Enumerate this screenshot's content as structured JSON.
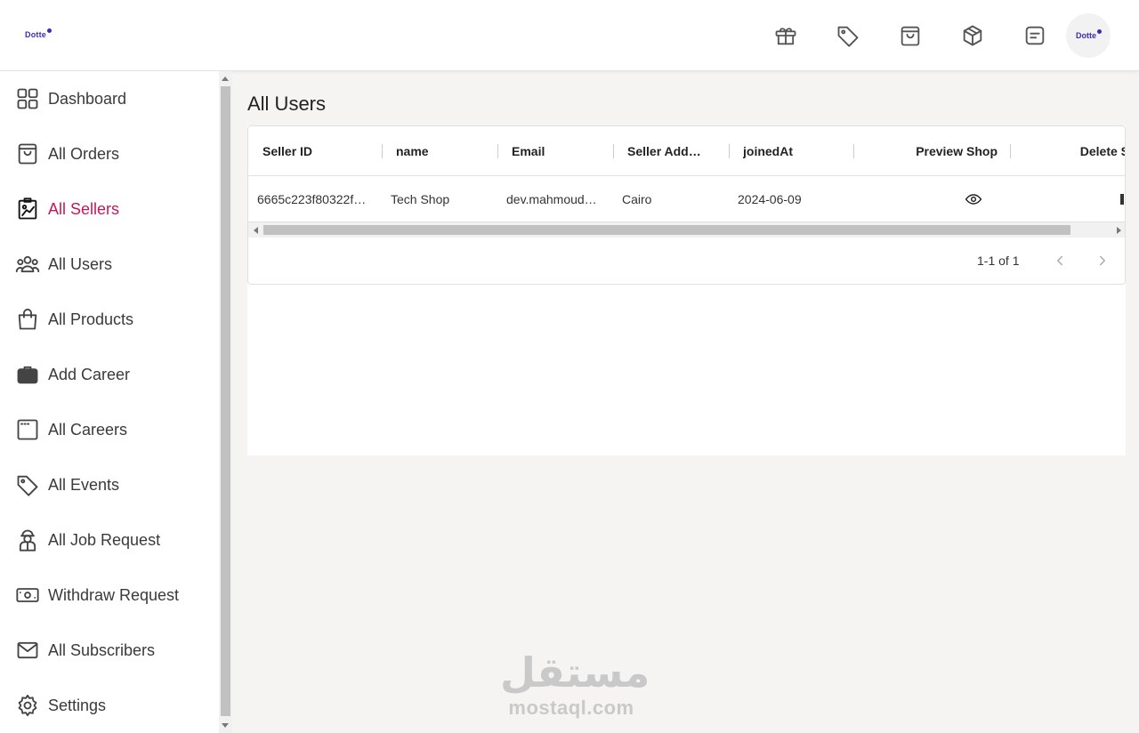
{
  "brand": {
    "logo_text": "Dotte",
    "avatar_text": "Dotte",
    "accent_color": "#3d2bb5"
  },
  "header": {
    "icons": [
      "gift-icon",
      "tag-icon",
      "shopping-bag-icon",
      "package-icon",
      "note-icon"
    ]
  },
  "sidebar": {
    "active_color": "#c2185b",
    "items": [
      {
        "label": "Dashboard",
        "icon": "dashboard-icon",
        "active": false
      },
      {
        "label": "All Orders",
        "icon": "shopping-bag-icon",
        "active": false
      },
      {
        "label": "All Sellers",
        "icon": "seller-icon",
        "active": true
      },
      {
        "label": "All Users",
        "icon": "users-icon",
        "active": false
      },
      {
        "label": "All Products",
        "icon": "product-bag-icon",
        "active": false
      },
      {
        "label": "Add Career",
        "icon": "briefcase-icon",
        "active": false
      },
      {
        "label": "All Careers",
        "icon": "window-icon",
        "active": false
      },
      {
        "label": "All Events",
        "icon": "tag-icon",
        "active": false
      },
      {
        "label": "All Job Request",
        "icon": "worker-icon",
        "active": false
      },
      {
        "label": "Withdraw Request",
        "icon": "money-icon",
        "active": false
      },
      {
        "label": "All Subscribers",
        "icon": "mail-icon",
        "active": false
      },
      {
        "label": "Settings",
        "icon": "gear-icon",
        "active": false
      }
    ]
  },
  "main": {
    "title": "All Users",
    "table": {
      "columns": [
        "Seller ID",
        "name",
        "Email",
        "Seller Add…",
        "joinedAt",
        "Preview Shop",
        "Delete S"
      ],
      "rows": [
        {
          "seller_id": "6665c223f80322f…",
          "name": "Tech Shop",
          "email": "dev.mahmoud…",
          "address": "Cairo",
          "joined_at": "2024-06-09"
        }
      ],
      "pagination": "1-1 of 1"
    }
  },
  "watermark": {
    "arabic": "مستقل",
    "latin": "mostaql.com"
  }
}
